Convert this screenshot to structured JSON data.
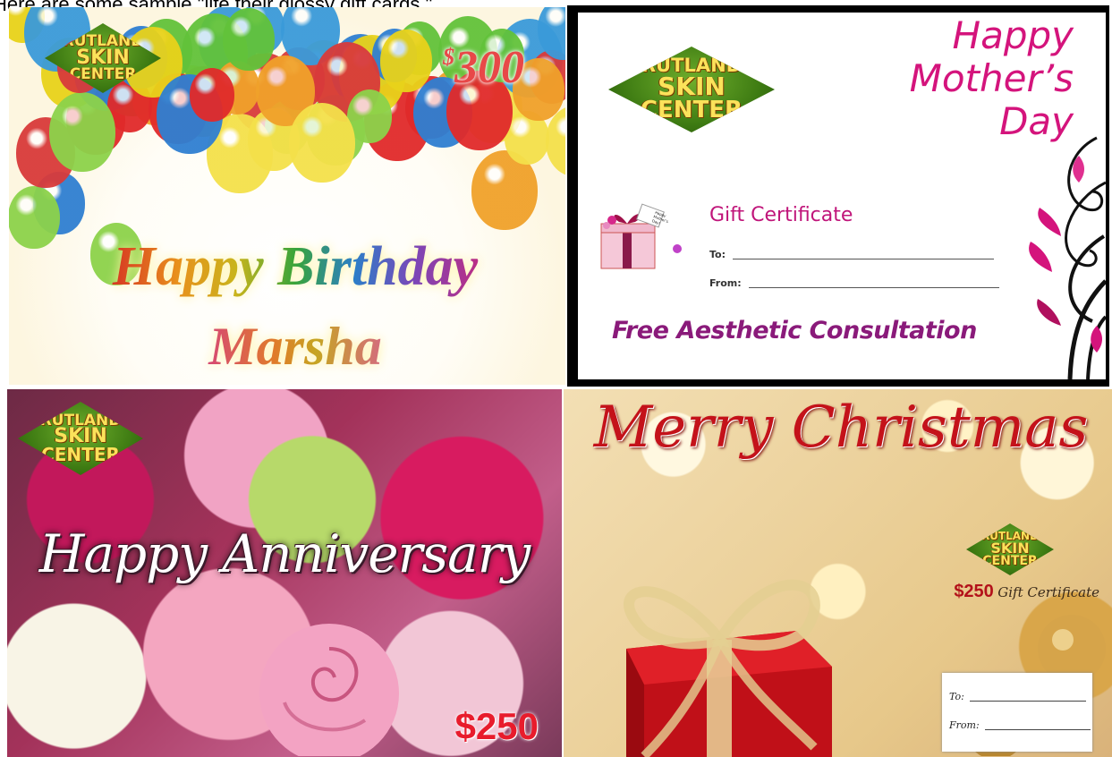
{
  "intro_text": "Here are some sample \"life their glossy gift cards.\"",
  "logo": {
    "line1": "RUTLAND",
    "line2": "SKIN",
    "line3": "CENTER"
  },
  "cards": {
    "birthday": {
      "amount_symbol": "$",
      "amount": "300",
      "title": "Happy Birthday",
      "name": "Marsha"
    },
    "mothers_day": {
      "title_line1": "Happy",
      "title_line2": "Mother’s",
      "title_line3": "Day",
      "gift_label": "Gift Certificate",
      "to_label": "To:",
      "from_label": "From:",
      "offer": "Free Aesthetic Consultation",
      "tag_text": "Happy Mother's Day!"
    },
    "anniversary": {
      "title": "Happy Anniversary",
      "amount": "$250"
    },
    "christmas": {
      "title": "Merry Christmas",
      "amount": "$250",
      "gift_label": "Gift Certificate",
      "to_label": "To:",
      "from_label": "From:"
    }
  },
  "colors": {
    "mothers_magenta": "#d4147c",
    "christmas_red": "#c4121a",
    "anniversary_amount_red": "#e81c2c",
    "logo_green": "#3d7a12",
    "logo_yellow": "#fbe25a"
  }
}
